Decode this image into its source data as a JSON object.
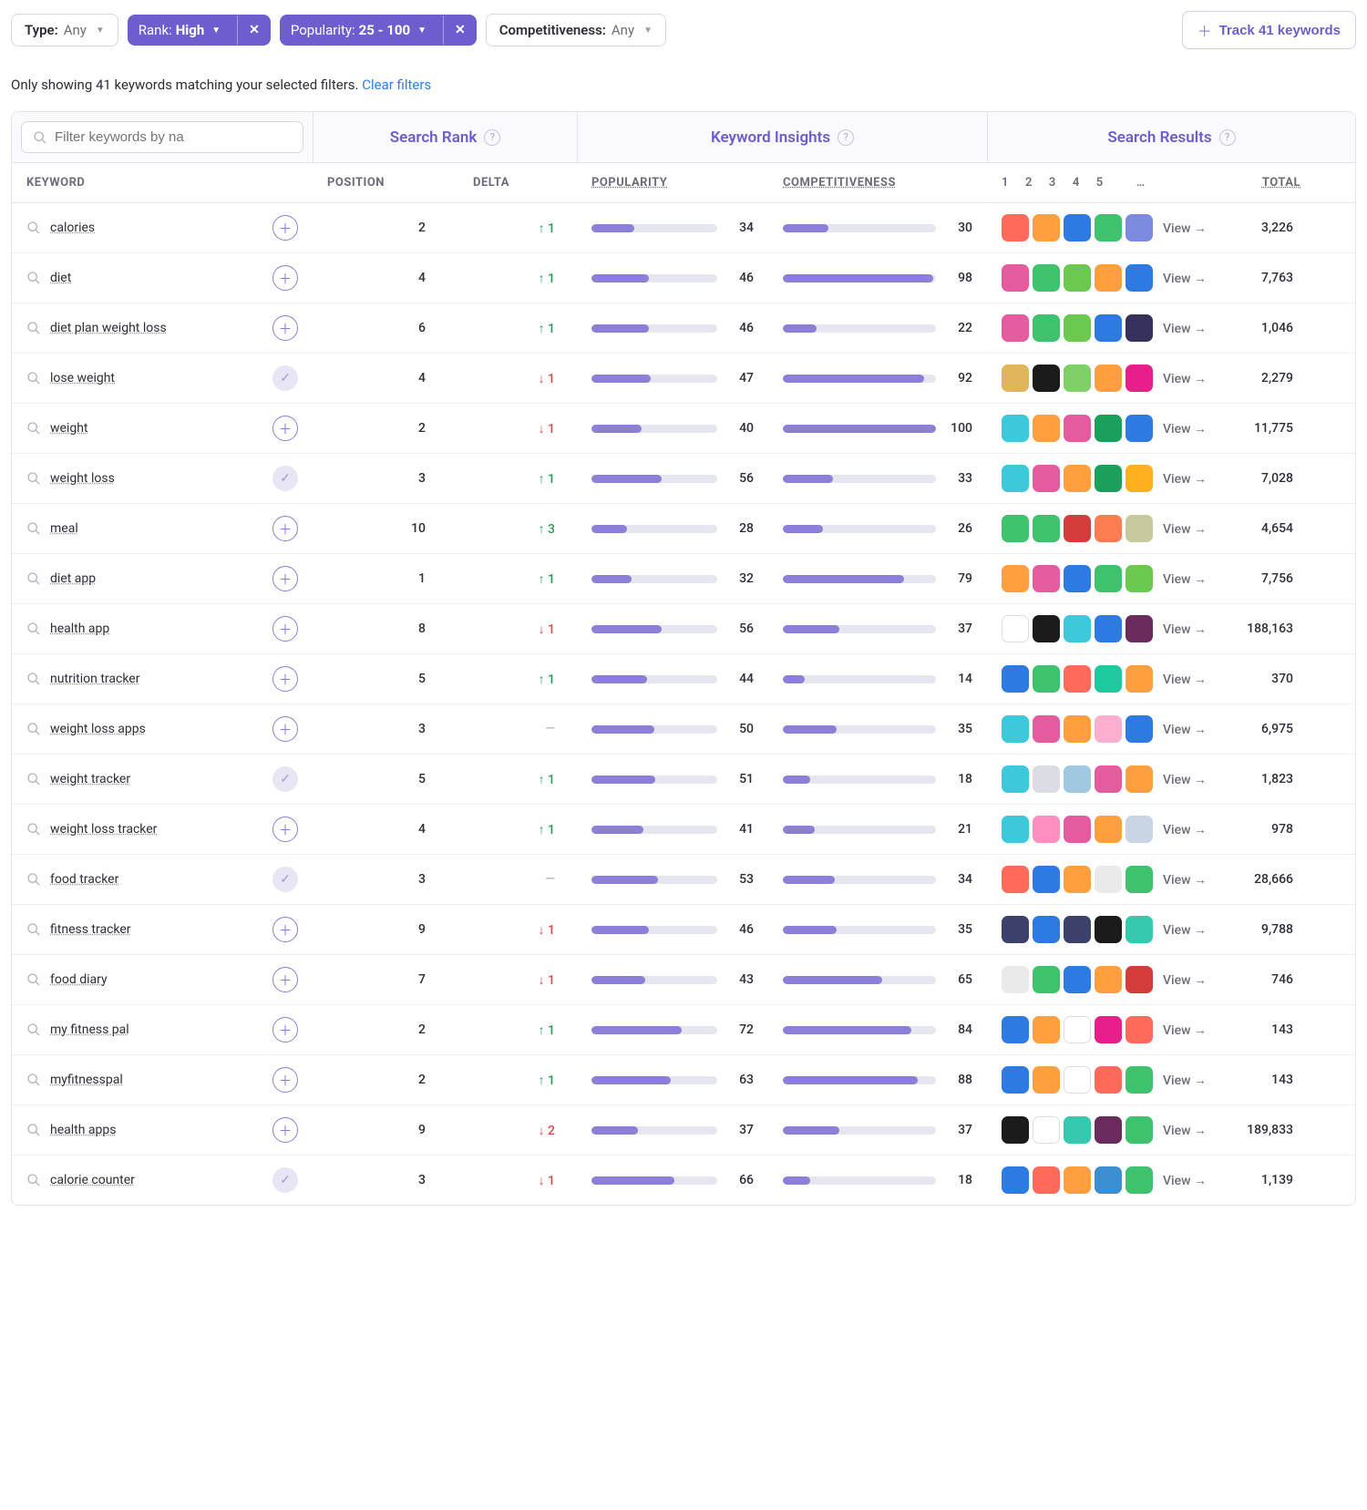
{
  "filters": {
    "type": {
      "label": "Type:",
      "value": "Any"
    },
    "rank": {
      "label": "Rank:",
      "value": "High"
    },
    "popularity": {
      "label": "Popularity:",
      "value": "25 - 100"
    },
    "competitiveness": {
      "label": "Competitiveness:",
      "value": "Any"
    }
  },
  "track_button": "Track 41 keywords",
  "status_text": "Only showing 41 keywords matching your selected filters.",
  "clear_filters": "Clear filters",
  "search_placeholder": "Filter keywords by na",
  "group_headers": {
    "rank": "Search Rank",
    "insights": "Keyword Insights",
    "results": "Search Results"
  },
  "columns": {
    "keyword": "KEYWORD",
    "position": "POSITION",
    "delta": "DELTA",
    "popularity": "POPULARITY",
    "competitiveness": "COMPETITIVENESS",
    "nums": [
      "1",
      "2",
      "3",
      "4",
      "5"
    ],
    "ellipsis": "…",
    "total": "TOTAL"
  },
  "view_label": "View",
  "rows": [
    {
      "keyword": "calories",
      "added": false,
      "position": 2,
      "delta": 1,
      "popularity": 34,
      "competitiveness": 30,
      "apps": [
        "#ff6b5b",
        "#ff9f40",
        "#2d7be0",
        "#3ec26e",
        "#7c8ae0"
      ],
      "total": "3,226"
    },
    {
      "keyword": "diet",
      "added": false,
      "position": 4,
      "delta": 1,
      "popularity": 46,
      "competitiveness": 98,
      "apps": [
        "#e55ba0",
        "#3ec26e",
        "#6bc950",
        "#ff9f40",
        "#2d7be0"
      ],
      "total": "7,763"
    },
    {
      "keyword": "diet plan weight loss",
      "added": false,
      "position": 6,
      "delta": 1,
      "popularity": 46,
      "competitiveness": 22,
      "apps": [
        "#e55ba0",
        "#3ec26e",
        "#6bc950",
        "#2d7be0",
        "#35315c"
      ],
      "total": "1,046"
    },
    {
      "keyword": "lose weight",
      "added": true,
      "position": 4,
      "delta": -1,
      "popularity": 47,
      "competitiveness": 92,
      "apps": [
        "#e0b55b",
        "#1b1b1b",
        "#7fd066",
        "#ff9f40",
        "#e81e8b"
      ],
      "total": "2,279"
    },
    {
      "keyword": "weight",
      "added": false,
      "position": 2,
      "delta": -1,
      "popularity": 40,
      "competitiveness": 100,
      "apps": [
        "#3bc9db",
        "#ff9f40",
        "#e55ba0",
        "#1aa05a",
        "#2d7be0"
      ],
      "total": "11,775"
    },
    {
      "keyword": "weight loss",
      "added": true,
      "position": 3,
      "delta": 1,
      "popularity": 56,
      "competitiveness": 33,
      "apps": [
        "#3bc9db",
        "#e55ba0",
        "#ff9f40",
        "#1aa05a",
        "#ffb020"
      ],
      "total": "7,028"
    },
    {
      "keyword": "meal",
      "added": false,
      "position": 10,
      "delta": 3,
      "popularity": 28,
      "competitiveness": 26,
      "apps": [
        "#3ec26e",
        "#3ec26e",
        "#d43b3b",
        "#ff7d52",
        "#c9c9a0"
      ],
      "total": "4,654"
    },
    {
      "keyword": "diet app",
      "added": false,
      "position": 1,
      "delta": 1,
      "popularity": 32,
      "competitiveness": 79,
      "apps": [
        "#ff9f40",
        "#e55ba0",
        "#2d7be0",
        "#3ec26e",
        "#6bc950"
      ],
      "total": "7,756"
    },
    {
      "keyword": "health app",
      "added": false,
      "position": 8,
      "delta": -1,
      "popularity": 56,
      "competitiveness": 37,
      "apps": [
        "#ffffff",
        "#1b1b1b",
        "#3bc9db",
        "#2d7be0",
        "#6b2b5c"
      ],
      "total": "188,163"
    },
    {
      "keyword": "nutrition tracker",
      "added": false,
      "position": 5,
      "delta": 1,
      "popularity": 44,
      "competitiveness": 14,
      "apps": [
        "#2d7be0",
        "#3ec26e",
        "#ff6b5b",
        "#1ec9a0",
        "#ff9f40"
      ],
      "total": "370"
    },
    {
      "keyword": "weight loss apps",
      "added": false,
      "position": 3,
      "delta": 0,
      "popularity": 50,
      "competitiveness": 35,
      "apps": [
        "#3bc9db",
        "#e55ba0",
        "#ff9f40",
        "#ffb0d0",
        "#2d7be0"
      ],
      "total": "6,975"
    },
    {
      "keyword": "weight tracker",
      "added": true,
      "position": 5,
      "delta": 1,
      "popularity": 51,
      "competitiveness": 18,
      "apps": [
        "#3bc9db",
        "#dcdce5",
        "#a0c8e0",
        "#e55ba0",
        "#ff9f40"
      ],
      "total": "1,823"
    },
    {
      "keyword": "weight loss tracker",
      "added": false,
      "position": 4,
      "delta": 1,
      "popularity": 41,
      "competitiveness": 21,
      "apps": [
        "#3bc9db",
        "#ff8fc0",
        "#e55ba0",
        "#ff9f40",
        "#c9d4e5"
      ],
      "total": "978"
    },
    {
      "keyword": "food tracker",
      "added": true,
      "position": 3,
      "delta": 0,
      "popularity": 53,
      "competitiveness": 34,
      "apps": [
        "#ff6b5b",
        "#2d7be0",
        "#ff9f40",
        "#eaeaea",
        "#3ec26e"
      ],
      "total": "28,666"
    },
    {
      "keyword": "fitness tracker",
      "added": false,
      "position": 9,
      "delta": -1,
      "popularity": 46,
      "competitiveness": 35,
      "apps": [
        "#3b416b",
        "#2d7be0",
        "#3b416b",
        "#1b1b1b",
        "#35c9b0"
      ],
      "total": "9,788"
    },
    {
      "keyword": "food diary",
      "added": false,
      "position": 7,
      "delta": -1,
      "popularity": 43,
      "competitiveness": 65,
      "apps": [
        "#eaeaea",
        "#3ec26e",
        "#2d7be0",
        "#ff9f40",
        "#d43b3b"
      ],
      "total": "746"
    },
    {
      "keyword": "my fitness pal",
      "added": false,
      "position": 2,
      "delta": 1,
      "popularity": 72,
      "competitiveness": 84,
      "apps": [
        "#2d7be0",
        "#ff9f40",
        "#ffffff",
        "#e81e8b",
        "#ff6b5b"
      ],
      "total": "143"
    },
    {
      "keyword": "myfitnesspal",
      "added": false,
      "position": 2,
      "delta": 1,
      "popularity": 63,
      "competitiveness": 88,
      "apps": [
        "#2d7be0",
        "#ff9f40",
        "#ffffff",
        "#ff6b5b",
        "#3ec26e"
      ],
      "total": "143"
    },
    {
      "keyword": "health apps",
      "added": false,
      "position": 9,
      "delta": -2,
      "popularity": 37,
      "competitiveness": 37,
      "apps": [
        "#1b1b1b",
        "#ffffff",
        "#35c9b0",
        "#6b2b5c",
        "#3ec26e"
      ],
      "total": "189,833"
    },
    {
      "keyword": "calorie counter",
      "added": true,
      "position": 3,
      "delta": -1,
      "popularity": 66,
      "competitiveness": 18,
      "apps": [
        "#2d7be0",
        "#ff6b5b",
        "#ff9f40",
        "#3b8fd0",
        "#3ec26e"
      ],
      "total": "1,139"
    }
  ]
}
